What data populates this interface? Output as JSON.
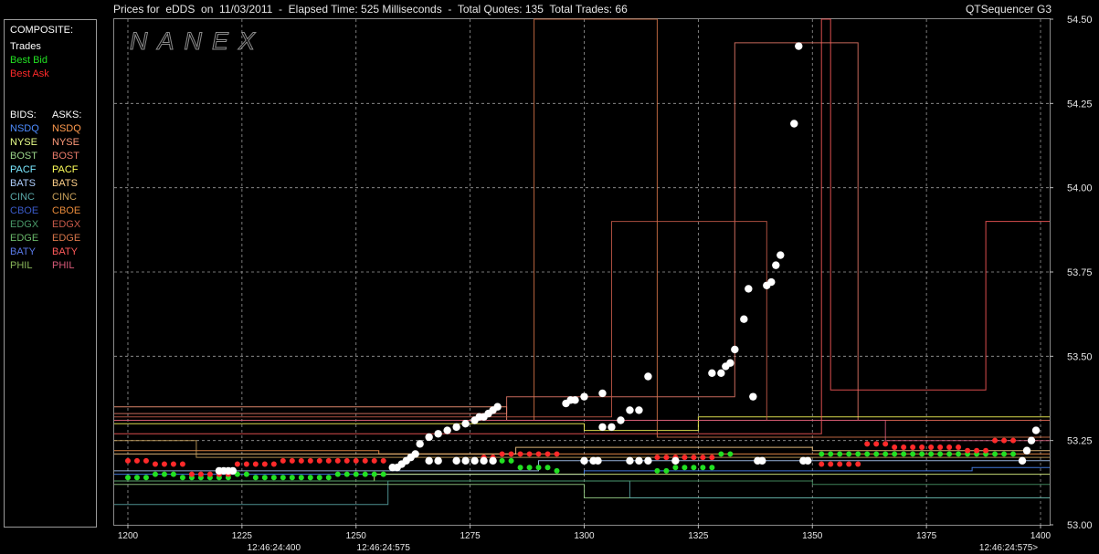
{
  "window": {
    "title": "Prices for  eDDS  on  11/03/2011  -  Elapsed Time: 525 Milliseconds  -  Total Quotes: 135  Total Trades: 66",
    "app_name": "QTSequencer G3",
    "watermark": "NANEX"
  },
  "legend": {
    "composite_header": "COMPOSITE:",
    "composite": [
      {
        "label": "Trades",
        "color": "#ffffff"
      },
      {
        "label": "Best Bid",
        "color": "#22e022"
      },
      {
        "label": "Best Ask",
        "color": "#ff2a2a"
      }
    ],
    "bids_header": "BIDS:",
    "asks_header": "ASKS:",
    "exchanges": [
      {
        "bid": "NSDQ",
        "bid_color": "#4d8cff",
        "ask": "NSDQ",
        "ask_color": "#ff9a4d"
      },
      {
        "bid": "NYSE",
        "bid_color": "#e8ff8a",
        "ask": "NYSE",
        "ask_color": "#ff9a7a"
      },
      {
        "bid": "BOST",
        "bid_color": "#9ad48a",
        "ask": "BOST",
        "ask_color": "#e87a6a"
      },
      {
        "bid": "PACF",
        "bid_color": "#7ae8ff",
        "ask": "PACF",
        "ask_color": "#ffff5a"
      },
      {
        "bid": "BATS",
        "bid_color": "#b0d0ff",
        "ask": "BATS",
        "ask_color": "#ffd08a"
      },
      {
        "bid": "CINC",
        "bid_color": "#5aa8a8",
        "ask": "CINC",
        "ask_color": "#c8a05a"
      },
      {
        "bid": "CBOE",
        "bid_color": "#3a5ac8",
        "ask": "CBOE",
        "ask_color": "#e88a3a"
      },
      {
        "bid": "EDGX",
        "bid_color": "#4a9a6a",
        "ask": "EDGX",
        "ask_color": "#c85a4a"
      },
      {
        "bid": "EDGE",
        "bid_color": "#6ab86a",
        "ask": "EDGE",
        "ask_color": "#d8764a"
      },
      {
        "bid": "BATY",
        "bid_color": "#5a7ae8",
        "ask": "BATY",
        "ask_color": "#ff5a5a"
      },
      {
        "bid": "PHIL",
        "bid_color": "#8ab85a",
        "ask": "PHIL",
        "ask_color": "#d85a7a"
      }
    ]
  },
  "chart_data": {
    "type": "scatter",
    "xlabel": "",
    "ylabel": "",
    "xlim": [
      1197,
      1402
    ],
    "ylim": [
      53.0,
      54.5
    ],
    "x_ticks": [
      1200,
      1225,
      1250,
      1275,
      1300,
      1325,
      1350,
      1375,
      1400
    ],
    "y_ticks": [
      53.0,
      53.25,
      53.5,
      53.75,
      54.0,
      54.25,
      54.5
    ],
    "y_tick_labels": [
      "53.00",
      "53.25",
      "53.50",
      "53.75",
      "54.00",
      "54.25",
      "54.50"
    ],
    "time_labels": [
      {
        "x": 1232,
        "label": "12:46:24:400"
      },
      {
        "x": 1256,
        "label": "12:46:24:575"
      },
      {
        "x": 1393,
        "label": "12:46:24:575>"
      }
    ],
    "grid": true,
    "trades": [
      [
        1220,
        53.16
      ],
      [
        1221,
        53.16
      ],
      [
        1222,
        53.16
      ],
      [
        1223,
        53.16
      ],
      [
        1258,
        53.17
      ],
      [
        1259,
        53.17
      ],
      [
        1260,
        53.18
      ],
      [
        1261,
        53.19
      ],
      [
        1262,
        53.2
      ],
      [
        1263,
        53.21
      ],
      [
        1264,
        53.24
      ],
      [
        1266,
        53.26
      ],
      [
        1268,
        53.27
      ],
      [
        1270,
        53.28
      ],
      [
        1272,
        53.29
      ],
      [
        1274,
        53.3
      ],
      [
        1276,
        53.31
      ],
      [
        1277,
        53.32
      ],
      [
        1278,
        53.32
      ],
      [
        1279,
        53.33
      ],
      [
        1280,
        53.34
      ],
      [
        1281,
        53.35
      ],
      [
        1266,
        53.19
      ],
      [
        1268,
        53.19
      ],
      [
        1272,
        53.19
      ],
      [
        1274,
        53.19
      ],
      [
        1276,
        53.19
      ],
      [
        1278,
        53.19
      ],
      [
        1280,
        53.19
      ],
      [
        1296,
        53.36
      ],
      [
        1297,
        53.37
      ],
      [
        1298,
        53.37
      ],
      [
        1300,
        53.38
      ],
      [
        1304,
        53.39
      ],
      [
        1300,
        53.19
      ],
      [
        1302,
        53.19
      ],
      [
        1303,
        53.19
      ],
      [
        1310,
        53.19
      ],
      [
        1312,
        53.19
      ],
      [
        1314,
        53.19
      ],
      [
        1304,
        53.29
      ],
      [
        1306,
        53.29
      ],
      [
        1308,
        53.31
      ],
      [
        1310,
        53.34
      ],
      [
        1312,
        53.34
      ],
      [
        1314,
        53.44
      ],
      [
        1320,
        53.19
      ],
      [
        1328,
        53.45
      ],
      [
        1330,
        53.45
      ],
      [
        1331,
        53.47
      ],
      [
        1332,
        53.48
      ],
      [
        1333,
        53.52
      ],
      [
        1335,
        53.61
      ],
      [
        1336,
        53.7
      ],
      [
        1337,
        53.38
      ],
      [
        1338,
        53.19
      ],
      [
        1339,
        53.19
      ],
      [
        1340,
        53.71
      ],
      [
        1341,
        53.72
      ],
      [
        1342,
        53.77
      ],
      [
        1343,
        53.8
      ],
      [
        1346,
        54.19
      ],
      [
        1347,
        54.42
      ],
      [
        1348,
        53.19
      ],
      [
        1349,
        53.19
      ],
      [
        1396,
        53.19
      ],
      [
        1397,
        53.22
      ],
      [
        1398,
        53.25
      ],
      [
        1399,
        53.28
      ]
    ],
    "best_bid": [
      [
        1200,
        53.14
      ],
      [
        1202,
        53.14
      ],
      [
        1204,
        53.14
      ],
      [
        1206,
        53.15
      ],
      [
        1208,
        53.15
      ],
      [
        1210,
        53.15
      ],
      [
        1212,
        53.14
      ],
      [
        1214,
        53.14
      ],
      [
        1216,
        53.14
      ],
      [
        1218,
        53.14
      ],
      [
        1220,
        53.14
      ],
      [
        1222,
        53.14
      ],
      [
        1224,
        53.15
      ],
      [
        1226,
        53.15
      ],
      [
        1228,
        53.14
      ],
      [
        1230,
        53.14
      ],
      [
        1232,
        53.14
      ],
      [
        1234,
        53.14
      ],
      [
        1236,
        53.14
      ],
      [
        1238,
        53.14
      ],
      [
        1240,
        53.14
      ],
      [
        1242,
        53.14
      ],
      [
        1244,
        53.14
      ],
      [
        1246,
        53.15
      ],
      [
        1248,
        53.15
      ],
      [
        1250,
        53.15
      ],
      [
        1252,
        53.15
      ],
      [
        1254,
        53.15
      ],
      [
        1256,
        53.15
      ],
      [
        1278,
        53.19
      ],
      [
        1280,
        53.19
      ],
      [
        1282,
        53.19
      ],
      [
        1284,
        53.19
      ],
      [
        1286,
        53.17
      ],
      [
        1288,
        53.17
      ],
      [
        1290,
        53.17
      ],
      [
        1292,
        53.17
      ],
      [
        1294,
        53.16
      ],
      [
        1316,
        53.16
      ],
      [
        1318,
        53.16
      ],
      [
        1320,
        53.17
      ],
      [
        1322,
        53.17
      ],
      [
        1324,
        53.17
      ],
      [
        1326,
        53.17
      ],
      [
        1328,
        53.17
      ],
      [
        1330,
        53.21
      ],
      [
        1332,
        53.21
      ],
      [
        1352,
        53.21
      ],
      [
        1354,
        53.21
      ],
      [
        1356,
        53.21
      ],
      [
        1358,
        53.21
      ],
      [
        1360,
        53.21
      ],
      [
        1362,
        53.21
      ],
      [
        1364,
        53.21
      ],
      [
        1366,
        53.21
      ],
      [
        1368,
        53.21
      ],
      [
        1370,
        53.21
      ],
      [
        1372,
        53.21
      ],
      [
        1374,
        53.21
      ],
      [
        1376,
        53.21
      ],
      [
        1378,
        53.21
      ],
      [
        1380,
        53.21
      ],
      [
        1382,
        53.21
      ],
      [
        1384,
        53.21
      ],
      [
        1386,
        53.21
      ],
      [
        1388,
        53.21
      ],
      [
        1390,
        53.21
      ],
      [
        1392,
        53.21
      ],
      [
        1394,
        53.21
      ]
    ],
    "best_ask": [
      [
        1200,
        53.19
      ],
      [
        1202,
        53.19
      ],
      [
        1204,
        53.19
      ],
      [
        1206,
        53.18
      ],
      [
        1208,
        53.18
      ],
      [
        1210,
        53.18
      ],
      [
        1212,
        53.18
      ],
      [
        1214,
        53.15
      ],
      [
        1216,
        53.15
      ],
      [
        1218,
        53.15
      ],
      [
        1220,
        53.15
      ],
      [
        1222,
        53.15
      ],
      [
        1224,
        53.18
      ],
      [
        1226,
        53.18
      ],
      [
        1228,
        53.18
      ],
      [
        1230,
        53.18
      ],
      [
        1232,
        53.18
      ],
      [
        1234,
        53.19
      ],
      [
        1236,
        53.19
      ],
      [
        1238,
        53.19
      ],
      [
        1240,
        53.19
      ],
      [
        1242,
        53.19
      ],
      [
        1244,
        53.19
      ],
      [
        1246,
        53.19
      ],
      [
        1248,
        53.19
      ],
      [
        1250,
        53.19
      ],
      [
        1252,
        53.19
      ],
      [
        1254,
        53.19
      ],
      [
        1256,
        53.19
      ],
      [
        1278,
        53.2
      ],
      [
        1280,
        53.2
      ],
      [
        1282,
        53.21
      ],
      [
        1284,
        53.21
      ],
      [
        1286,
        53.21
      ],
      [
        1288,
        53.21
      ],
      [
        1290,
        53.21
      ],
      [
        1292,
        53.21
      ],
      [
        1294,
        53.21
      ],
      [
        1316,
        53.2
      ],
      [
        1318,
        53.2
      ],
      [
        1320,
        53.2
      ],
      [
        1322,
        53.2
      ],
      [
        1324,
        53.2
      ],
      [
        1326,
        53.2
      ],
      [
        1328,
        53.2
      ],
      [
        1352,
        53.18
      ],
      [
        1354,
        53.18
      ],
      [
        1356,
        53.18
      ],
      [
        1358,
        53.18
      ],
      [
        1360,
        53.18
      ],
      [
        1362,
        53.24
      ],
      [
        1364,
        53.24
      ],
      [
        1366,
        53.24
      ],
      [
        1368,
        53.23
      ],
      [
        1370,
        53.23
      ],
      [
        1372,
        53.23
      ],
      [
        1374,
        53.23
      ],
      [
        1376,
        53.23
      ],
      [
        1378,
        53.23
      ],
      [
        1380,
        53.23
      ],
      [
        1382,
        53.23
      ],
      [
        1384,
        53.22
      ],
      [
        1386,
        53.22
      ],
      [
        1388,
        53.22
      ],
      [
        1390,
        53.25
      ],
      [
        1392,
        53.25
      ],
      [
        1394,
        53.25
      ]
    ],
    "exchange_lines": [
      {
        "name": "NSDQ bid",
        "color": "#4d8cff",
        "points": [
          [
            1197,
            53.15
          ],
          [
            1300,
            53.15
          ],
          [
            1300,
            53.16
          ],
          [
            1385,
            53.16
          ],
          [
            1385,
            53.17
          ],
          [
            1402,
            53.17
          ]
        ]
      },
      {
        "name": "NSDQ ask",
        "color": "#ff9a4d",
        "points": [
          [
            1197,
            53.22
          ],
          [
            1255,
            53.22
          ],
          [
            1255,
            53.21
          ],
          [
            1402,
            53.21
          ]
        ]
      },
      {
        "name": "NYSE bid",
        "color": "#e8ff8a",
        "points": [
          [
            1197,
            53.13
          ],
          [
            1254,
            53.13
          ],
          [
            1254,
            53.15
          ],
          [
            1402,
            53.15
          ]
        ]
      },
      {
        "name": "NYSE ask",
        "color": "#ff9a7a",
        "points": [
          [
            1197,
            53.35
          ],
          [
            1283,
            53.35
          ],
          [
            1283,
            53.31
          ],
          [
            1402,
            53.31
          ]
        ]
      },
      {
        "name": "BOST bid",
        "color": "#9ad48a",
        "points": [
          [
            1197,
            53.12
          ],
          [
            1300,
            53.12
          ],
          [
            1300,
            53.08
          ],
          [
            1402,
            53.08
          ]
        ]
      },
      {
        "name": "BOST ask",
        "color": "#e87a6a",
        "points": [
          [
            1197,
            53.33
          ],
          [
            1283,
            53.33
          ],
          [
            1283,
            53.38
          ],
          [
            1333,
            53.38
          ],
          [
            1333,
            54.43
          ],
          [
            1360,
            54.43
          ],
          [
            1360,
            53.31
          ],
          [
            1402,
            53.31
          ]
        ]
      },
      {
        "name": "PACF ask",
        "color": "#ffff5a",
        "points": [
          [
            1197,
            53.3
          ],
          [
            1300,
            53.3
          ],
          [
            1300,
            53.28
          ],
          [
            1325,
            53.28
          ],
          [
            1325,
            53.32
          ],
          [
            1402,
            53.32
          ]
        ]
      },
      {
        "name": "BATS bid",
        "color": "#b0d0ff",
        "points": [
          [
            1197,
            53.16
          ],
          [
            1290,
            53.16
          ],
          [
            1290,
            53.19
          ],
          [
            1402,
            53.19
          ]
        ]
      },
      {
        "name": "BATS ask",
        "color": "#ffd08a",
        "points": [
          [
            1197,
            53.21
          ],
          [
            1285,
            53.21
          ],
          [
            1285,
            53.23
          ],
          [
            1350,
            53.23
          ],
          [
            1350,
            53.22
          ],
          [
            1402,
            53.22
          ]
        ]
      },
      {
        "name": "CINC bid",
        "color": "#5aa8a8",
        "points": [
          [
            1197,
            53.06
          ],
          [
            1257,
            53.06
          ],
          [
            1257,
            53.13
          ],
          [
            1310,
            53.13
          ],
          [
            1310,
            53.08
          ],
          [
            1402,
            53.08
          ]
        ]
      },
      {
        "name": "CINC ask",
        "color": "#c8a05a",
        "points": [
          [
            1197,
            53.25
          ],
          [
            1215,
            53.25
          ],
          [
            1215,
            53.2
          ],
          [
            1402,
            53.2
          ]
        ]
      },
      {
        "name": "EDGX bid",
        "color": "#4a9a6a",
        "points": [
          [
            1197,
            53.13
          ],
          [
            1350,
            53.13
          ],
          [
            1350,
            53.12
          ],
          [
            1402,
            53.12
          ]
        ]
      },
      {
        "name": "EDGX ask",
        "color": "#c85a4a",
        "points": [
          [
            1197,
            53.32
          ],
          [
            1306,
            53.32
          ],
          [
            1306,
            53.9
          ],
          [
            1340,
            53.9
          ],
          [
            1340,
            53.31
          ],
          [
            1402,
            53.31
          ]
        ]
      },
      {
        "name": "EDGE ask",
        "color": "#d8764a",
        "points": [
          [
            1197,
            53.31
          ],
          [
            1289,
            53.31
          ],
          [
            1289,
            54.5
          ],
          [
            1316,
            54.5
          ],
          [
            1316,
            53.26
          ],
          [
            1402,
            53.26
          ]
        ]
      },
      {
        "name": "BATY ask",
        "color": "#ff5a5a",
        "points": [
          [
            1197,
            53.27
          ],
          [
            1352,
            53.27
          ],
          [
            1352,
            54.5
          ],
          [
            1354,
            54.5
          ],
          [
            1354,
            53.4
          ],
          [
            1388,
            53.4
          ],
          [
            1388,
            53.9
          ],
          [
            1402,
            53.9
          ]
        ]
      },
      {
        "name": "PHIL ask",
        "color": "#d85a7a",
        "points": [
          [
            1197,
            53.31
          ],
          [
            1366,
            53.31
          ],
          [
            1366,
            53.25
          ],
          [
            1402,
            53.25
          ]
        ]
      }
    ]
  }
}
